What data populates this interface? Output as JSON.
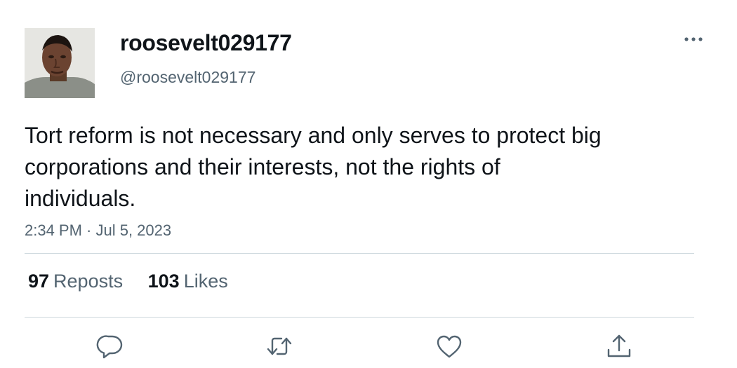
{
  "user": {
    "display_name": "roosevelt029177",
    "handle": "@roosevelt029177"
  },
  "tweet": {
    "text": "Tort reform is not necessary and only serves to protect big corporations and their interests, not the rights of individuals.",
    "timestamp": "2:34 PM · Jul 5, 2023"
  },
  "stats": {
    "reposts_count": "97",
    "reposts_label": "Reposts",
    "likes_count": "103",
    "likes_label": "Likes"
  },
  "icons": {
    "more": "more-horizontal-icon",
    "reply": "reply-icon",
    "repost": "repost-icon",
    "like": "heart-icon",
    "share": "share-icon"
  },
  "colors": {
    "text_primary": "#0f1419",
    "text_secondary": "#536471",
    "divider": "#cfd9de"
  }
}
